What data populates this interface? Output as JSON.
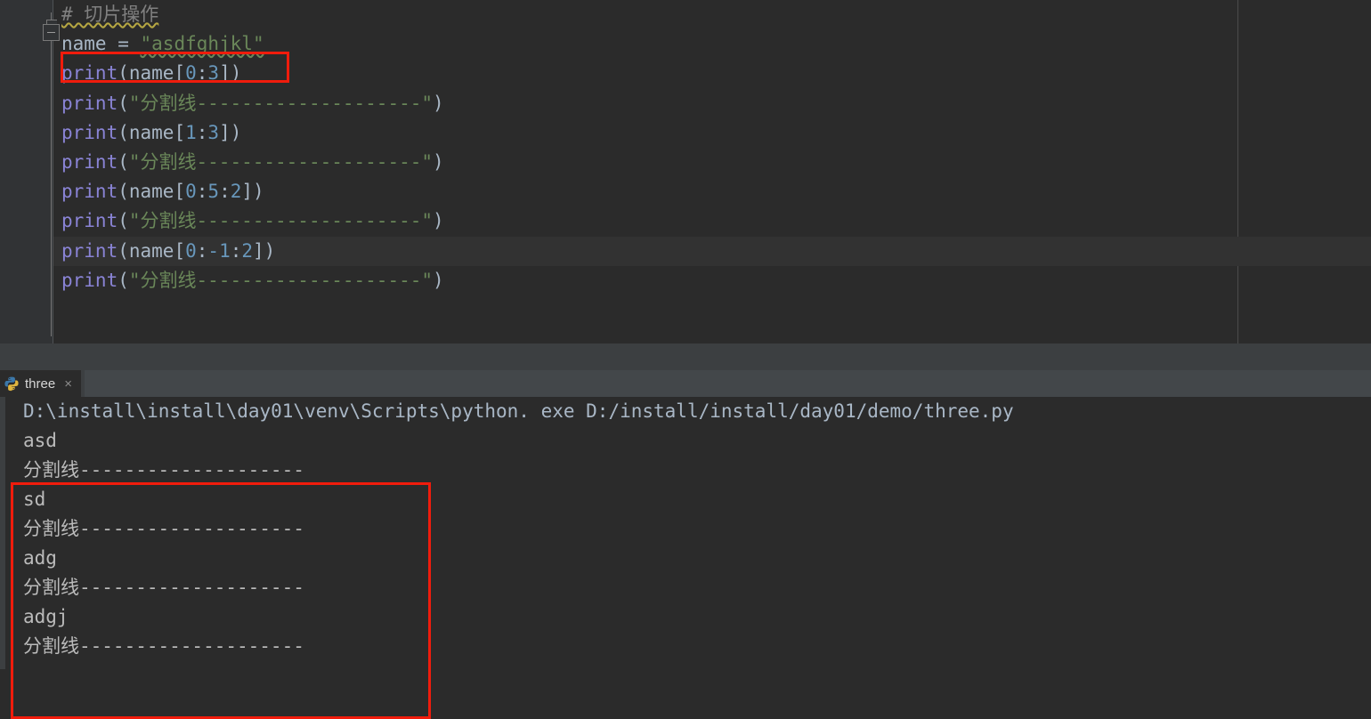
{
  "editor": {
    "code_lines": [
      {
        "id": "comment-line",
        "current": false,
        "tokens": [
          {
            "cls": "tok-comment wavy-yellow",
            "text": "# 切片操作"
          }
        ]
      },
      {
        "id": "assignment-line",
        "current": false,
        "tokens": [
          {
            "cls": "tok-plain",
            "text": "name = "
          },
          {
            "cls": "tok-str wavy-green",
            "text": "\"asdfghjkl\""
          }
        ]
      },
      {
        "id": "print-0-3",
        "current": false,
        "tokens": [
          {
            "cls": "tok-kw",
            "text": "print"
          },
          {
            "cls": "tok-punct",
            "text": "("
          },
          {
            "cls": "tok-plain",
            "text": "name"
          },
          {
            "cls": "tok-punct",
            "text": "["
          },
          {
            "cls": "tok-num",
            "text": "0"
          },
          {
            "cls": "tok-punct",
            "text": ":"
          },
          {
            "cls": "tok-num",
            "text": "3"
          },
          {
            "cls": "tok-punct",
            "text": "])"
          }
        ]
      },
      {
        "id": "print-sep-1",
        "current": false,
        "tokens": [
          {
            "cls": "tok-kw",
            "text": "print"
          },
          {
            "cls": "tok-punct",
            "text": "("
          },
          {
            "cls": "tok-str",
            "text": "\"分割线--------------------\""
          },
          {
            "cls": "tok-punct",
            "text": ")"
          }
        ]
      },
      {
        "id": "print-1-3",
        "current": false,
        "tokens": [
          {
            "cls": "tok-kw",
            "text": "print"
          },
          {
            "cls": "tok-punct",
            "text": "("
          },
          {
            "cls": "tok-plain",
            "text": "name"
          },
          {
            "cls": "tok-punct",
            "text": "["
          },
          {
            "cls": "tok-num",
            "text": "1"
          },
          {
            "cls": "tok-punct",
            "text": ":"
          },
          {
            "cls": "tok-num",
            "text": "3"
          },
          {
            "cls": "tok-punct",
            "text": "])"
          }
        ]
      },
      {
        "id": "print-sep-2",
        "current": false,
        "tokens": [
          {
            "cls": "tok-kw",
            "text": "print"
          },
          {
            "cls": "tok-punct",
            "text": "("
          },
          {
            "cls": "tok-str",
            "text": "\"分割线--------------------\""
          },
          {
            "cls": "tok-punct",
            "text": ")"
          }
        ]
      },
      {
        "id": "print-0-5-2",
        "current": false,
        "tokens": [
          {
            "cls": "tok-kw",
            "text": "print"
          },
          {
            "cls": "tok-punct",
            "text": "("
          },
          {
            "cls": "tok-plain",
            "text": "name"
          },
          {
            "cls": "tok-punct",
            "text": "["
          },
          {
            "cls": "tok-num",
            "text": "0"
          },
          {
            "cls": "tok-punct",
            "text": ":"
          },
          {
            "cls": "tok-num",
            "text": "5"
          },
          {
            "cls": "tok-punct",
            "text": ":"
          },
          {
            "cls": "tok-num",
            "text": "2"
          },
          {
            "cls": "tok-punct",
            "text": "])"
          }
        ]
      },
      {
        "id": "print-sep-3",
        "current": false,
        "tokens": [
          {
            "cls": "tok-kw",
            "text": "print"
          },
          {
            "cls": "tok-punct",
            "text": "("
          },
          {
            "cls": "tok-str",
            "text": "\"分割线--------------------\""
          },
          {
            "cls": "tok-punct",
            "text": ")"
          }
        ]
      },
      {
        "id": "print-0-neg1-2",
        "current": true,
        "tokens": [
          {
            "cls": "tok-kw",
            "text": "print"
          },
          {
            "cls": "tok-punct",
            "text": "("
          },
          {
            "cls": "tok-plain",
            "text": "name"
          },
          {
            "cls": "tok-punct",
            "text": "["
          },
          {
            "cls": "tok-num",
            "text": "0"
          },
          {
            "cls": "tok-punct",
            "text": ":"
          },
          {
            "cls": "tok-num",
            "text": "-1"
          },
          {
            "cls": "tok-punct",
            "text": ":"
          },
          {
            "cls": "tok-num",
            "text": "2"
          },
          {
            "cls": "tok-punct",
            "text": "])"
          }
        ]
      },
      {
        "id": "print-sep-4",
        "current": false,
        "tokens": [
          {
            "cls": "tok-kw",
            "text": "print"
          },
          {
            "cls": "tok-punct",
            "text": "("
          },
          {
            "cls": "tok-str",
            "text": "\"分割线--------------------\""
          },
          {
            "cls": "tok-punct",
            "text": ")"
          }
        ]
      }
    ],
    "fold_marker": "fold-collapse-icon",
    "annotation_color": "#f01c0c"
  },
  "panel": {
    "run_tab": {
      "icon": "python-file-icon",
      "label": "three",
      "close_label": "×"
    },
    "console": {
      "command_line": "D:\\install\\install\\day01\\venv\\Scripts\\python. exe D:/install/install/day01/demo/three.py",
      "output_lines": [
        "asd",
        "分割线--------------------",
        "sd",
        "分割线--------------------",
        "adg",
        "分割线--------------------",
        "adgj",
        "分割线--------------------"
      ]
    }
  }
}
